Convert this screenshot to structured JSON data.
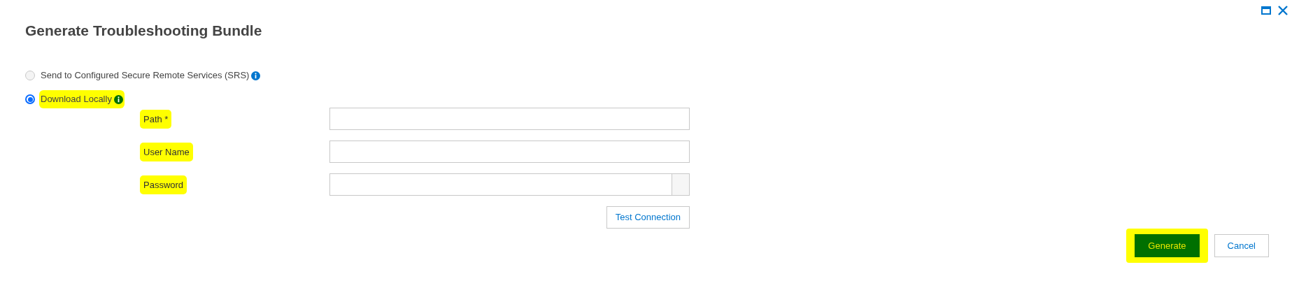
{
  "dialog": {
    "title": "Generate Troubleshooting Bundle"
  },
  "options": [
    {
      "label": "Send to Configured Secure Remote Services (SRS)",
      "selected": false,
      "highlighted": false,
      "color": "#0076ce"
    },
    {
      "label": "Download Locally",
      "selected": true,
      "highlighted": true,
      "color": "#007000"
    }
  ],
  "fields": [
    {
      "kind": "text",
      "label": "Path *",
      "highlighted": true
    },
    {
      "kind": "text",
      "label": "User Name",
      "highlighted": true
    },
    {
      "kind": "password",
      "label": "Password",
      "highlighted": true
    }
  ],
  "test_button": "Test Connection",
  "actions": [
    {
      "label": "Generate",
      "kind": "primary",
      "highlighted": true
    },
    {
      "label": "Cancel",
      "kind": "secondary",
      "highlighted": false
    }
  ]
}
